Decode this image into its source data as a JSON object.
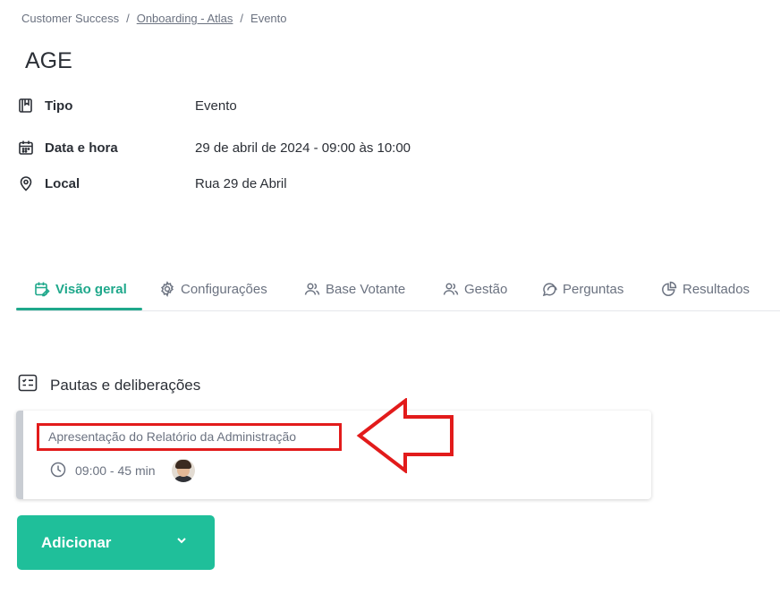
{
  "breadcrumb": {
    "root": "Customer Success",
    "parent": "Onboarding - Atlas",
    "current": "Evento",
    "separator": "/"
  },
  "page": {
    "title": "AGE"
  },
  "details": [
    {
      "icon": "book-icon",
      "label": "Tipo",
      "value": "Evento"
    },
    {
      "icon": "calendar-icon",
      "label": "Data e hora",
      "value": "29 de abril de 2024 - 09:00 às 10:00"
    },
    {
      "icon": "location-pin-icon",
      "label": "Local",
      "value": "Rua 29 de Abril"
    }
  ],
  "tabs": [
    {
      "icon": "calendar-edit-icon",
      "label": "Visão geral",
      "active": true
    },
    {
      "icon": "gear-icon",
      "label": "Configurações",
      "active": false
    },
    {
      "icon": "users-icon",
      "label": "Base Votante",
      "active": false
    },
    {
      "icon": "users-icon",
      "label": "Gestão",
      "active": false
    },
    {
      "icon": "chat-bubbles-icon",
      "label": "Perguntas",
      "active": false
    },
    {
      "icon": "pie-chart-icon",
      "label": "Resultados",
      "active": false
    }
  ],
  "section": {
    "icon": "checklist-icon",
    "title": "Pautas e deliberações"
  },
  "agenda_items": [
    {
      "title": "Apresentação do Relatório da Administração",
      "time": "09:00 - 45 min",
      "icon": "clock-icon",
      "avatar": "presenter-avatar"
    }
  ],
  "actions": {
    "add_label": "Adicionar",
    "add_icon": "chevron-down-icon"
  },
  "annotation": {
    "box_color": "#e21b1b",
    "arrow_color": "#e21b1b"
  },
  "colors": {
    "accent": "#1fa88b",
    "button": "#1fbf9a",
    "text": "#2b2f36",
    "muted": "#6b7280"
  }
}
